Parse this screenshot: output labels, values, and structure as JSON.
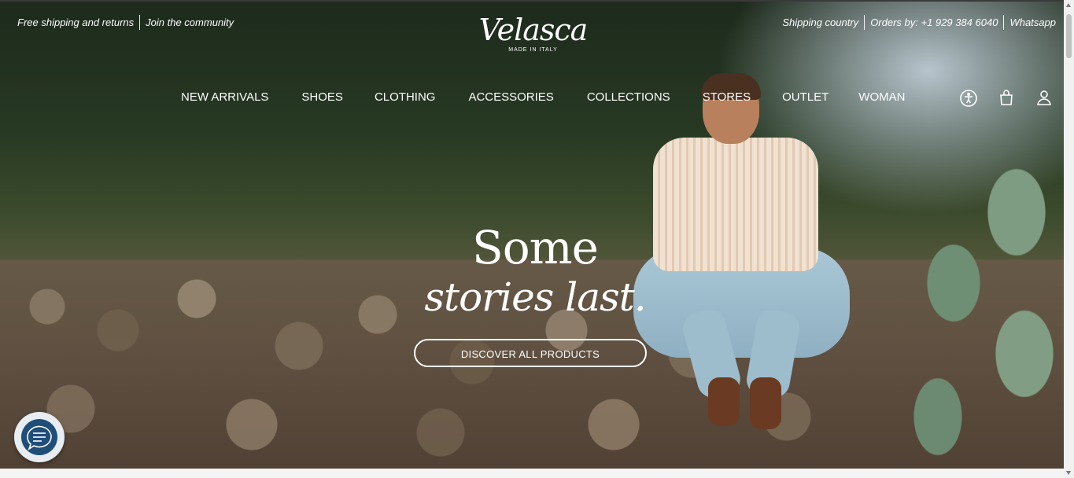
{
  "utility_left": {
    "shipping": "Free shipping and returns",
    "community": "Join the community"
  },
  "utility_right": {
    "country": "Shipping country",
    "orders": "Orders by: +1 929 384 6040",
    "whatsapp": "Whatsapp"
  },
  "logo": {
    "word": "Velasca",
    "tagline": "MADE IN ITALY"
  },
  "nav": {
    "items": [
      "NEW ARRIVALS",
      "SHOES",
      "CLOTHING",
      "ACCESSORIES",
      "COLLECTIONS",
      "STORES",
      "OUTLET",
      "WOMAN"
    ]
  },
  "icons": {
    "accessibility": "accessibility-icon",
    "bag": "shopping-bag-icon",
    "account": "user-icon",
    "chat": "chat-icon"
  },
  "hero": {
    "line1": "Some",
    "line2": "stories last.",
    "cta": "DISCOVER ALL PRODUCTS"
  },
  "colors": {
    "chat_button": "#1f4e79",
    "text": "#ffffff"
  }
}
